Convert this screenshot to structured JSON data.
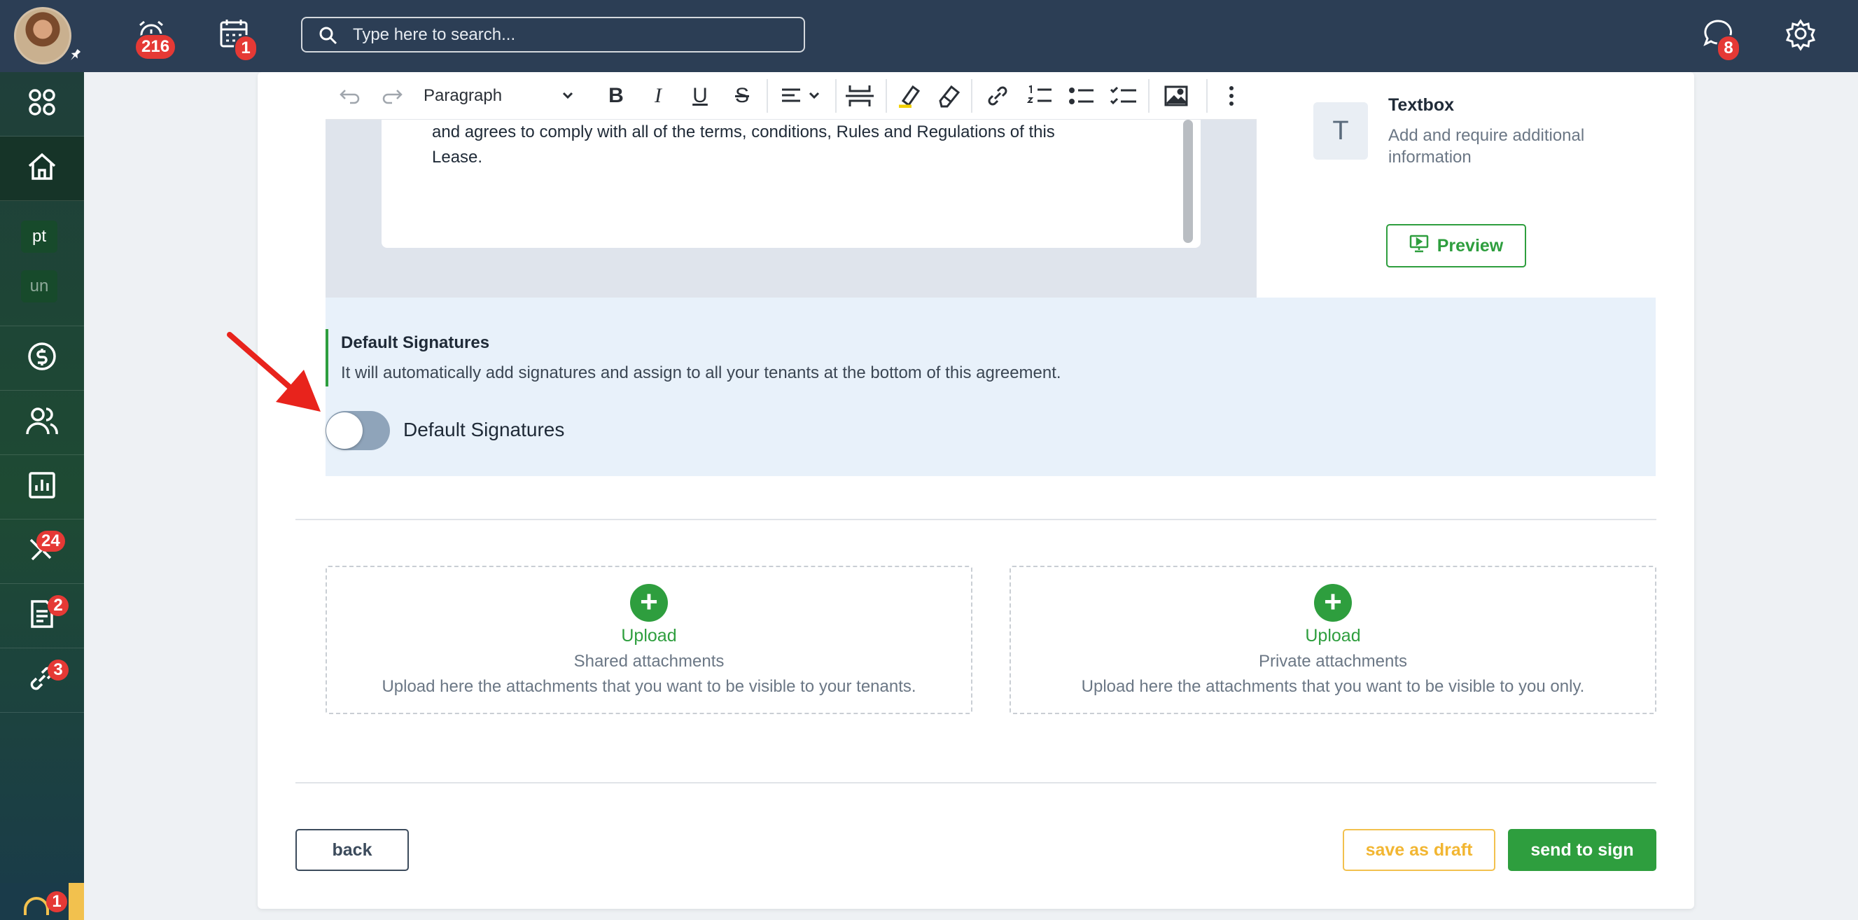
{
  "topbar": {
    "search_placeholder": "Type here to search...",
    "alarm_badge": "216",
    "calendar_badge": "1",
    "chat_badge": "8"
  },
  "sidebar": {
    "chip_pt": "pt",
    "chip_un": "un",
    "tools_badge": "24",
    "docs_badge": "2",
    "links_badge": "3",
    "support_badge": "1"
  },
  "editor": {
    "block_format": "Paragraph",
    "body_text": "and agrees to comply with all of the terms, conditions, Rules and Regulations of this Lease."
  },
  "textbox_widget": {
    "icon_letter": "T",
    "title": "Textbox",
    "description": "Add and require additional information",
    "preview_label": "Preview"
  },
  "default_signatures": {
    "title": "Default Signatures",
    "description": "It will automatically add signatures and assign to all your tenants at the bottom of this agreement.",
    "toggle_label": "Default Signatures",
    "enabled": false
  },
  "uploads": [
    {
      "link": "Upload",
      "title": "Shared attachments",
      "description": "Upload here the attachments that you want to be visible to your tenants."
    },
    {
      "link": "Upload",
      "title": "Private attachments",
      "description": "Upload here the attachments that you want to be visible to you only."
    }
  ],
  "actions": {
    "back_label": "back",
    "draft_label": "save as draft",
    "send_label": "send to sign"
  },
  "colors": {
    "topbar": "#2c3e55",
    "accent_green": "#2e9e3e",
    "draft_yellow": "#f2b632",
    "badge_red": "#e53935",
    "annotation_arrow": "#e8231c"
  }
}
